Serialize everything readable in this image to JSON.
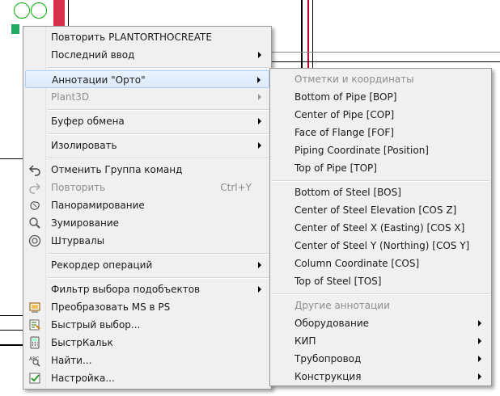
{
  "main_menu": {
    "items": [
      {
        "label": "Повторить PLANTORTHOCREATE"
      },
      {
        "label": "Последний ввод"
      },
      {
        "label": "Аннотации \"Орто\""
      },
      {
        "label": "Plant3D"
      },
      {
        "label": "Буфер обмена"
      },
      {
        "label": "Изолировать"
      },
      {
        "label": "Отменить Группа команд"
      },
      {
        "label": "Повторить",
        "shortcut": "Ctrl+Y"
      },
      {
        "label": "Панорамирование"
      },
      {
        "label": "Зумирование"
      },
      {
        "label": "Штурвалы"
      },
      {
        "label": "Рекордер операций"
      },
      {
        "label": "Фильтр выбора подобъектов"
      },
      {
        "label": "Преобразовать MS в PS"
      },
      {
        "label": "Быстрый выбор..."
      },
      {
        "label": "БыстрКальк"
      },
      {
        "label": "Найти..."
      },
      {
        "label": "Настройка..."
      }
    ]
  },
  "sub_menu": {
    "header1": "Отметки и координаты",
    "items1": [
      "Bottom of Pipe [BOP]",
      "Center of Pipe [COP]",
      "Face of Flange [FOF]",
      "Piping Coordinate [Position]",
      "Top of Pipe [TOP]"
    ],
    "items2": [
      "Bottom of Steel [BOS]",
      "Center of Steel Elevation [COS Z]",
      "Center of Steel X (Easting) [COS X]",
      "Center of Steel Y (Northing) [COS Y]",
      "Column Coordinate [COS]",
      "Top of Steel [TOS]"
    ],
    "header2": "Другие аннотации",
    "items3": [
      "Оборудование",
      "КИП",
      "Трубопровод",
      "Конструкция"
    ]
  },
  "colors": {
    "highlight": "#dbeafa",
    "menu_bg": "#f0f0f0"
  }
}
